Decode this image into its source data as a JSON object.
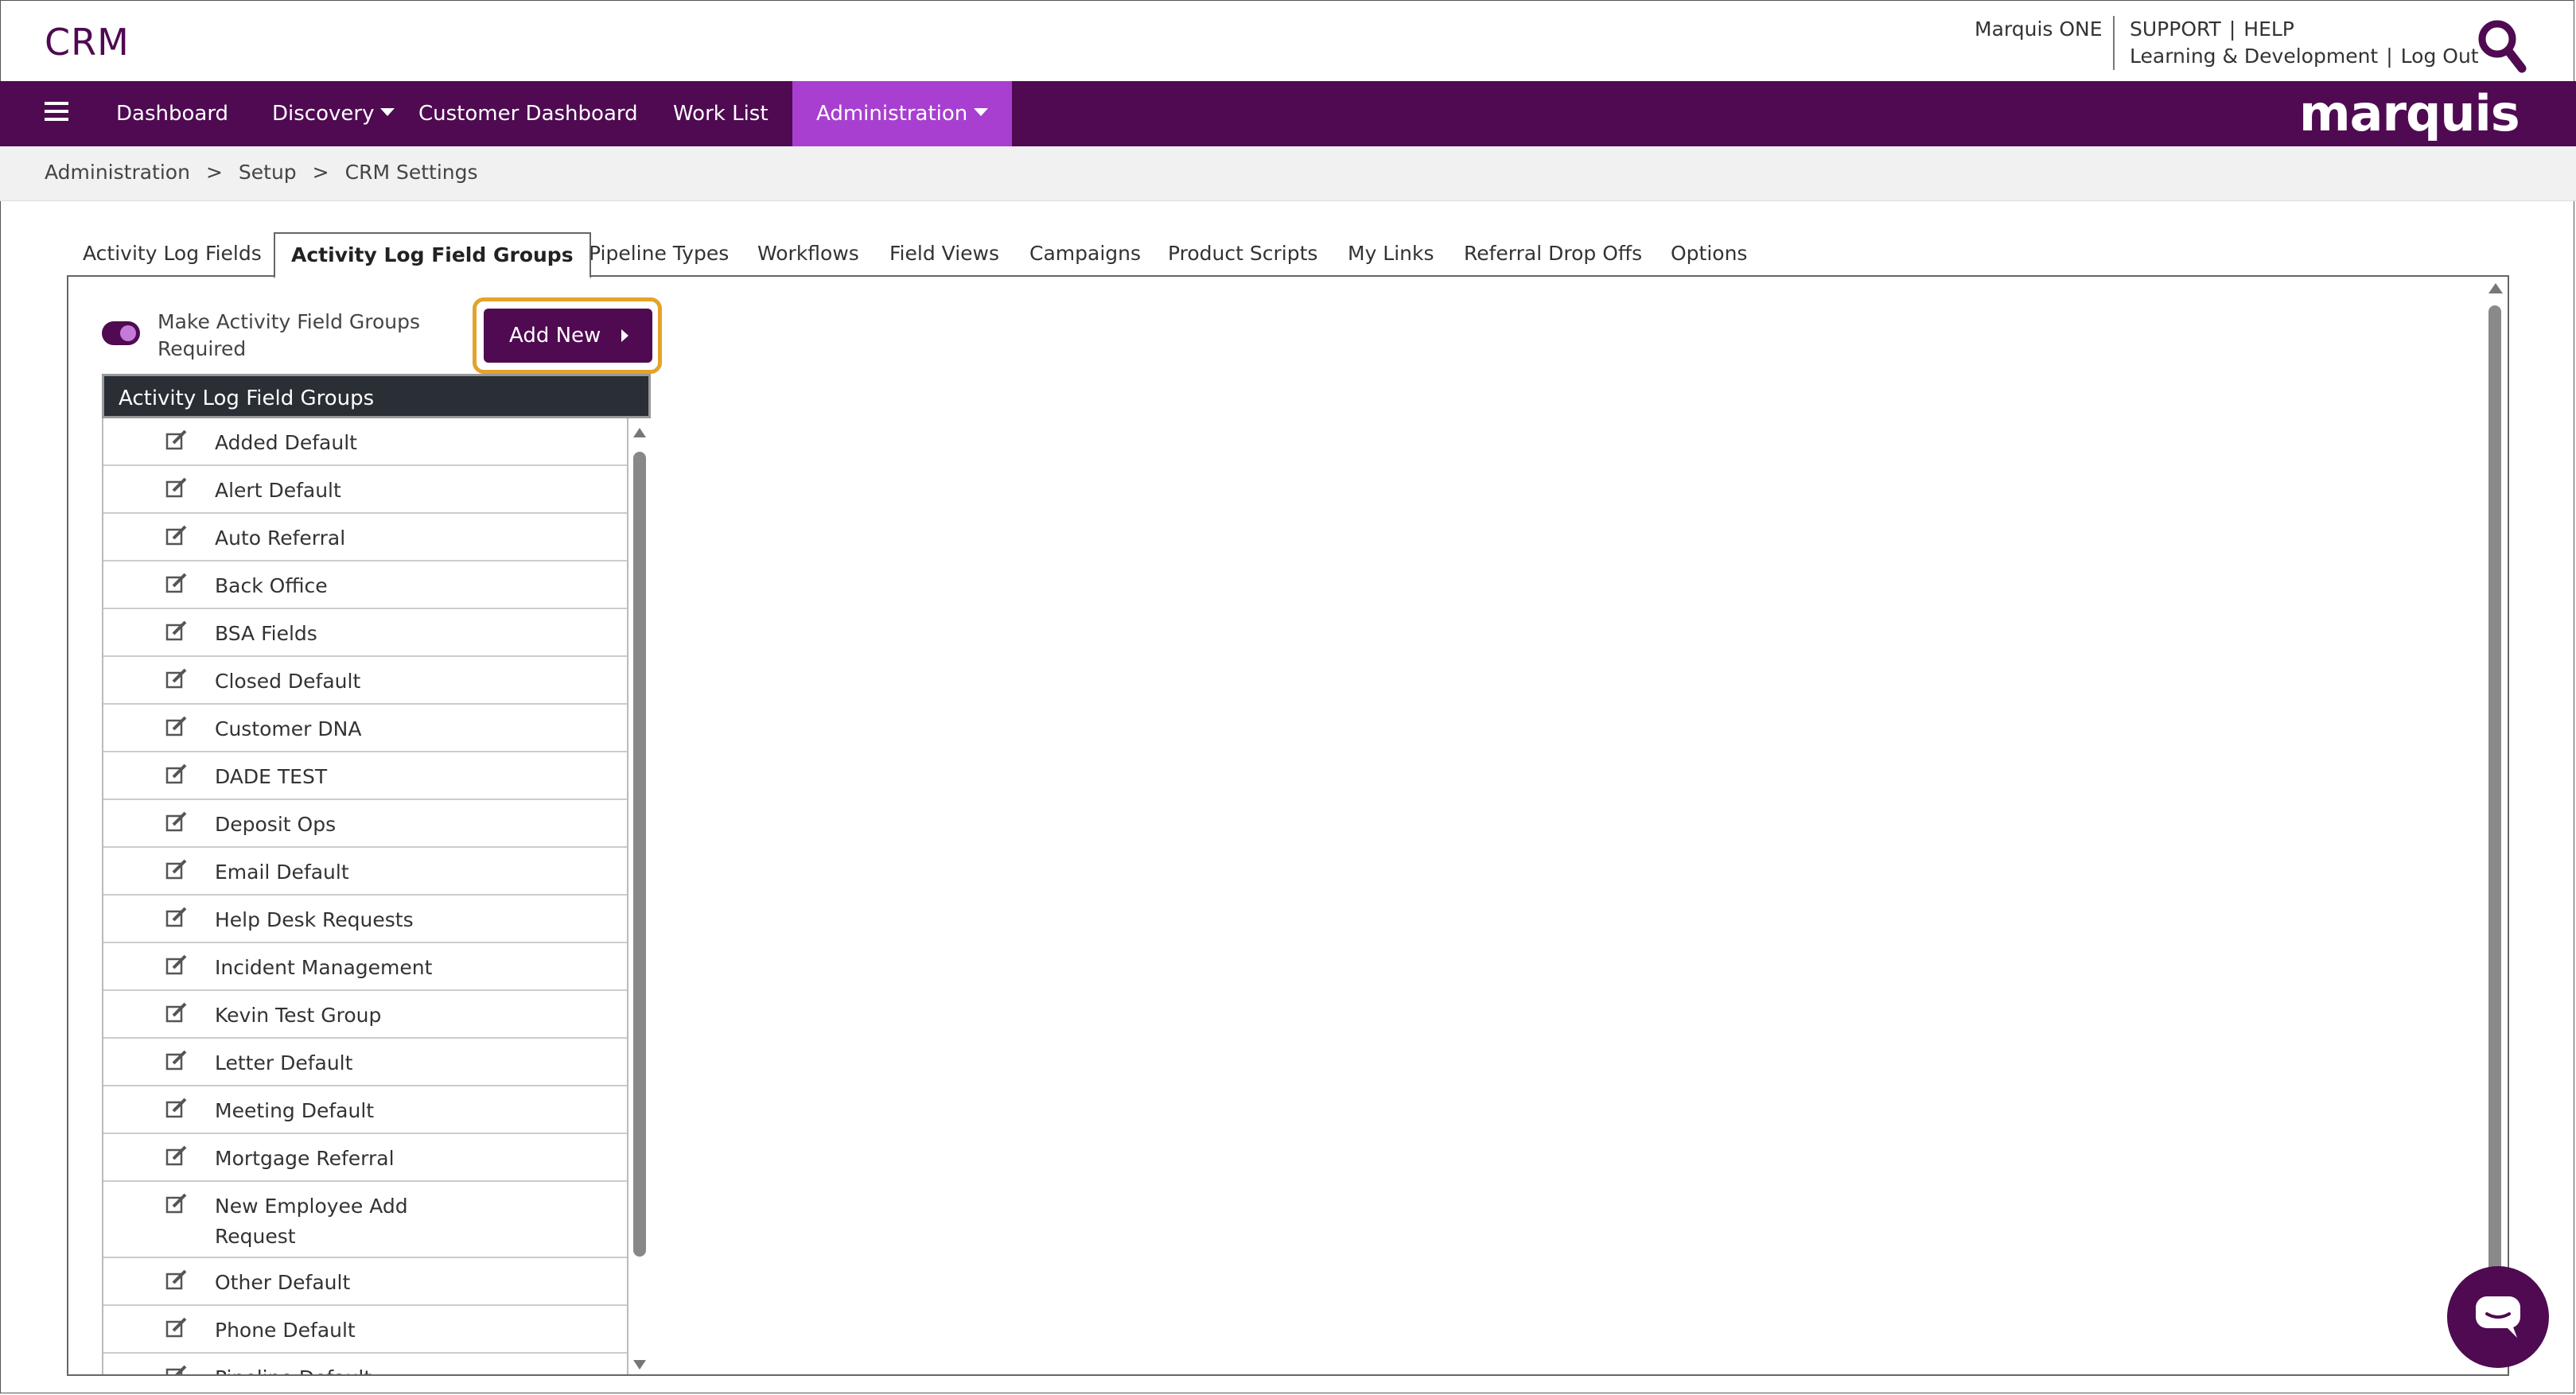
{
  "header": {
    "app_title": "CRM",
    "marquis_one": "Marquis ONE",
    "support": "SUPPORT",
    "help": "HELP",
    "learning": "Learning & Development",
    "logout": "Log Out",
    "divider": "|"
  },
  "nav": {
    "items": [
      {
        "label": "Dashboard"
      },
      {
        "label": "Discovery"
      },
      {
        "label": "Customer Dashboard"
      },
      {
        "label": "Work List"
      },
      {
        "label": "Administration"
      }
    ],
    "logo_text": "marquis",
    "accent_color": "#4f0a52",
    "active_color": "#a83fd1"
  },
  "breadcrumb": {
    "items": [
      "Administration",
      "Setup",
      "CRM Settings"
    ],
    "separator": ">"
  },
  "tabs": [
    {
      "label": "Activity Log Fields"
    },
    {
      "label": "Activity Log Field Groups",
      "active": true
    },
    {
      "label": "Pipeline Types"
    },
    {
      "label": "Workflows"
    },
    {
      "label": "Field Views"
    },
    {
      "label": "Campaigns"
    },
    {
      "label": "Product Scripts"
    },
    {
      "label": "My Links"
    },
    {
      "label": "Referral Drop Offs"
    },
    {
      "label": "Options"
    }
  ],
  "panel": {
    "toggle_label_line1": "Make Activity Field Groups",
    "toggle_label_line2": "Required",
    "toggle_on": true,
    "add_new_label": "Add New",
    "list_header": "Activity Log Field Groups",
    "groups": [
      {
        "name": "Added Default"
      },
      {
        "name": "Alert Default"
      },
      {
        "name": "Auto Referral"
      },
      {
        "name": "Back Office"
      },
      {
        "name": "BSA Fields"
      },
      {
        "name": "Closed Default"
      },
      {
        "name": "Customer DNA"
      },
      {
        "name": "DADE TEST"
      },
      {
        "name": "Deposit Ops"
      },
      {
        "name": "Email Default"
      },
      {
        "name": "Help Desk Requests"
      },
      {
        "name": "Incident Management"
      },
      {
        "name": "Kevin Test Group"
      },
      {
        "name": "Letter Default"
      },
      {
        "name": "Meeting Default"
      },
      {
        "name": "Mortgage Referral"
      },
      {
        "name_line1": "New Employee Add",
        "name_line2": "Request"
      },
      {
        "name": "Other Default"
      },
      {
        "name": "Phone Default"
      },
      {
        "name": "Pipeline Default"
      }
    ],
    "highlight_color": "#e3a32b"
  },
  "icons": {
    "search": "search-icon",
    "menu": "hamburger-menu-icon",
    "edit": "edit-icon",
    "chat": "chat-icon"
  }
}
